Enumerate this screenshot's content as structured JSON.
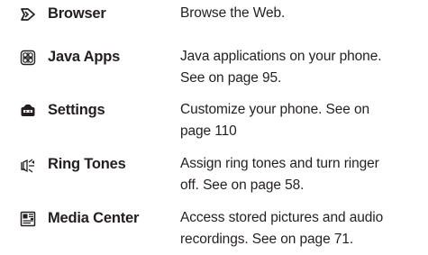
{
  "menu": {
    "items": [
      {
        "icon": "browser-icon",
        "name": "Browser",
        "desc": [
          "Browse the Web."
        ]
      },
      {
        "icon": "java-apps-icon",
        "name": "Java Apps",
        "desc": [
          "Java applications on your phone.",
          "See on page 95."
        ]
      },
      {
        "icon": "settings-icon",
        "name": "Settings",
        "desc": [
          "Customize your phone. See on",
          "page 110"
        ]
      },
      {
        "icon": "ring-tones-icon",
        "name": "Ring Tones",
        "desc": [
          "Assign ring tones and turn ringer",
          "off. See on page 58."
        ]
      },
      {
        "icon": "media-center-icon",
        "name": "Media Center",
        "desc": [
          "Access stored pictures and audio",
          "recordings. See on page 71."
        ]
      }
    ]
  }
}
